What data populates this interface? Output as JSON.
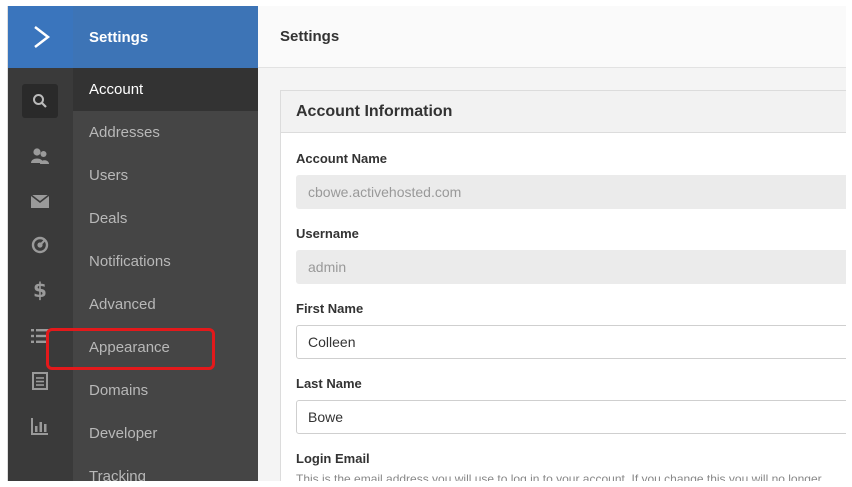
{
  "nav": {
    "title": "Settings",
    "items": [
      {
        "label": "Account",
        "active": true
      },
      {
        "label": "Addresses"
      },
      {
        "label": "Users"
      },
      {
        "label": "Deals"
      },
      {
        "label": "Notifications"
      },
      {
        "label": "Advanced"
      },
      {
        "label": "Appearance"
      },
      {
        "label": "Domains"
      },
      {
        "label": "Developer"
      },
      {
        "label": "Tracking"
      }
    ]
  },
  "header": {
    "title": "Settings"
  },
  "account_info": {
    "title": "Account Information",
    "account_name": {
      "label": "Account Name",
      "value": "cbowe.activehosted.com"
    },
    "username": {
      "label": "Username",
      "value": "admin"
    },
    "first_name": {
      "label": "First Name",
      "value": "Colleen"
    },
    "last_name": {
      "label": "Last Name",
      "value": "Bowe"
    },
    "login_email": {
      "label": "Login Email",
      "helper": "This is the email address you will use to log in to your account. If you change this you will no longer"
    }
  },
  "colors": {
    "brand_blue": "#3a75bd",
    "highlight_red": "#e3191b"
  }
}
